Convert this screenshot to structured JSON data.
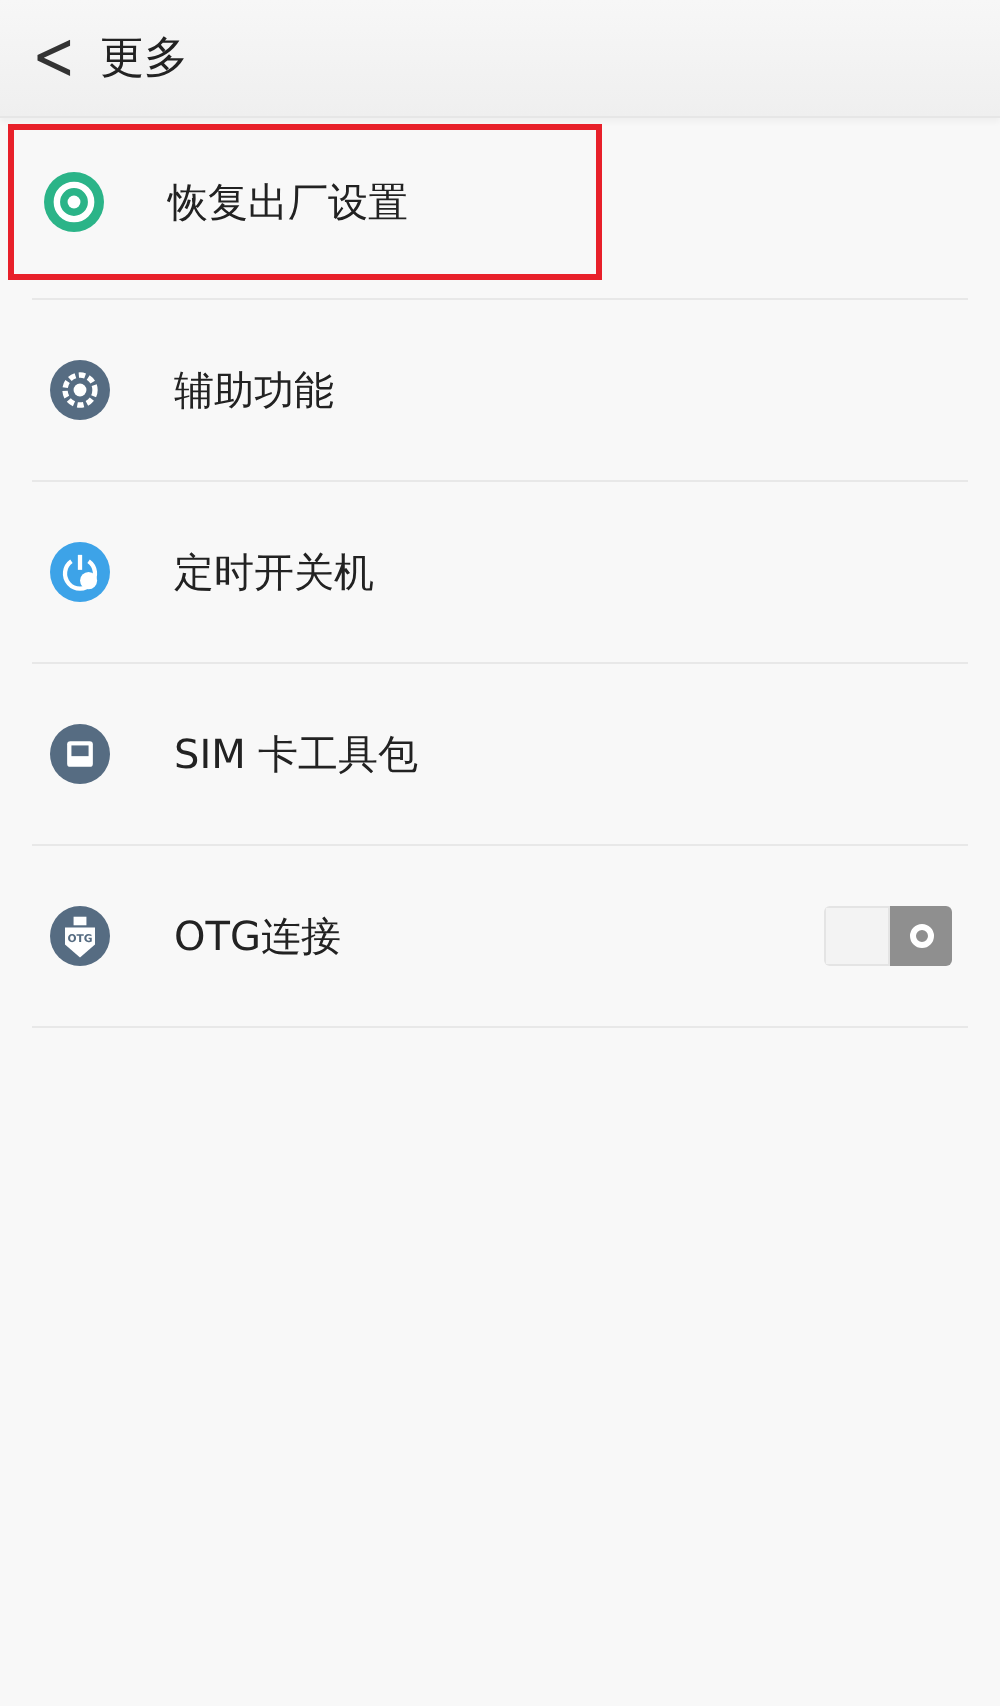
{
  "header": {
    "back": "<",
    "title": "更多"
  },
  "items": [
    {
      "label": "恢复出厂设置",
      "kind": "link",
      "highlighted": true
    },
    {
      "label": "辅助功能",
      "kind": "link",
      "highlighted": false
    },
    {
      "label": "定时开关机",
      "kind": "link",
      "highlighted": false
    },
    {
      "label": "SIM 卡工具包",
      "kind": "link",
      "highlighted": false
    },
    {
      "label": "OTG连接",
      "kind": "toggle",
      "highlighted": false,
      "icon_text": "OTG",
      "on": false
    }
  ]
}
